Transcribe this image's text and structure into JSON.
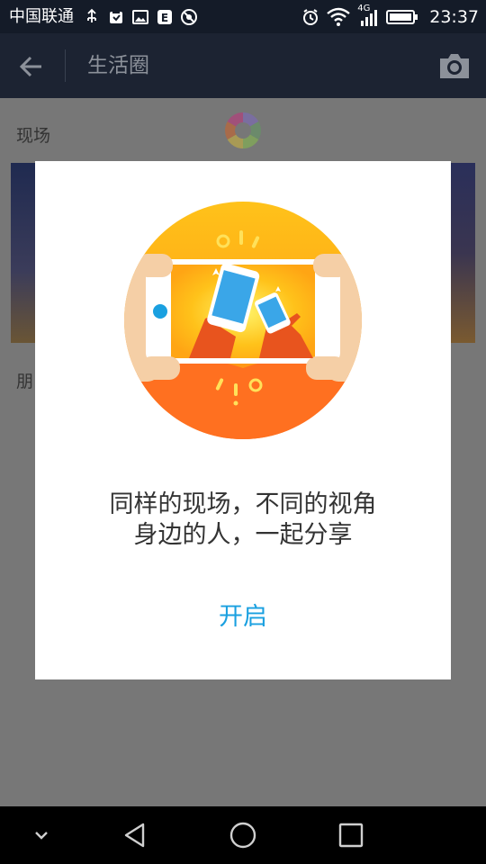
{
  "status_bar": {
    "carrier": "中国联通",
    "network_type": "4G",
    "time": "23:37",
    "icons_left": [
      "usb-icon",
      "notification-icon",
      "image-icon",
      "app-icon",
      "sync-icon"
    ],
    "icons_right": [
      "alarm-icon",
      "wifi-icon",
      "signal-icon",
      "battery-icon"
    ]
  },
  "app_bar": {
    "title": "生活圈"
  },
  "background": {
    "section_label": "现场",
    "section_label_2": "朋"
  },
  "dialog": {
    "line1": "同样的现场，不同的视角",
    "line2": "身边的人，一起分享",
    "button_label": "开启",
    "accent_color": "#1aa0e0"
  },
  "nav_bar": {
    "buttons": [
      "collapse-icon",
      "back-icon",
      "home-icon",
      "recents-icon"
    ]
  }
}
